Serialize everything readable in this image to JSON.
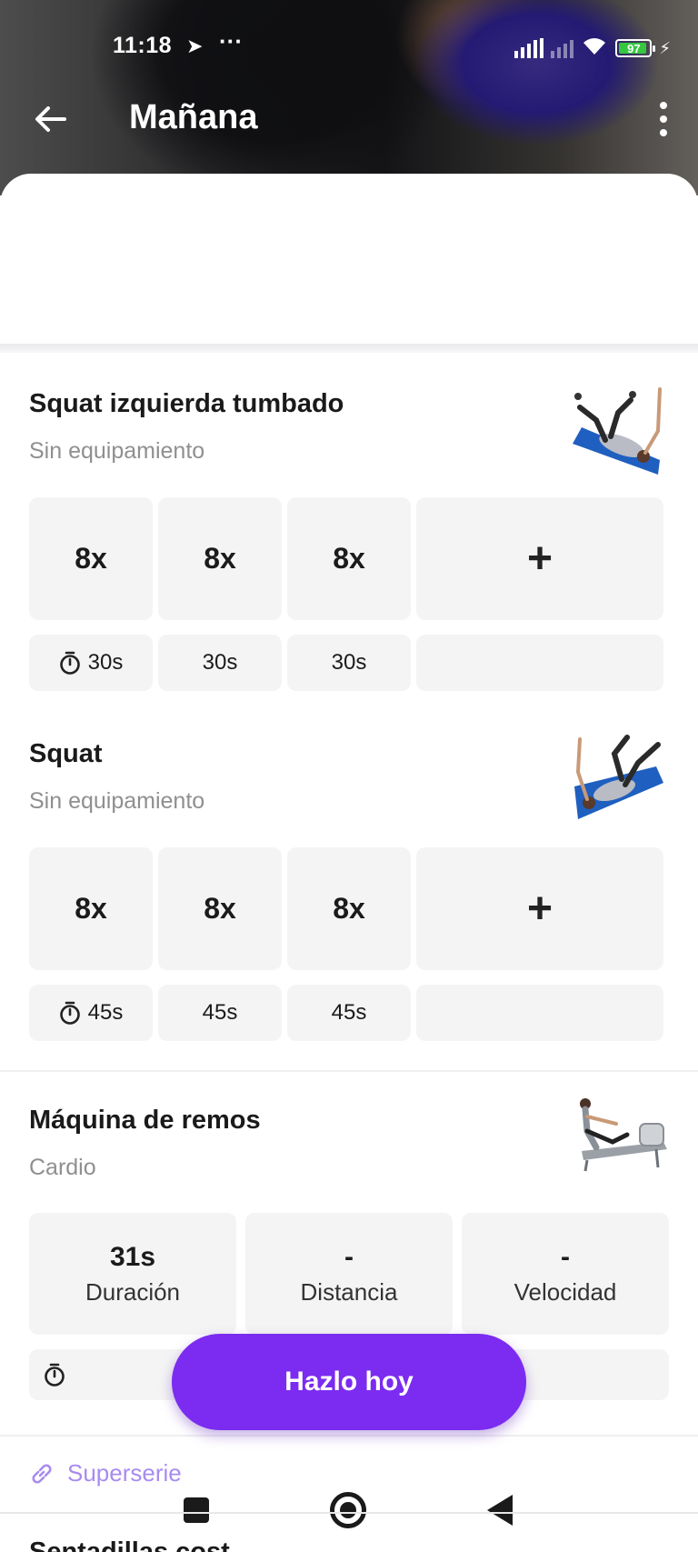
{
  "status_bar": {
    "time": "11:18",
    "battery": "97"
  },
  "header": {
    "title": "Mañana"
  },
  "exercises": [
    {
      "name": "Squat izquierda tumbado",
      "equipment": "Sin equipamiento",
      "reps": [
        "8x",
        "8x",
        "8x"
      ],
      "rests": [
        "30s",
        "30s",
        "30s"
      ]
    },
    {
      "name": "Squat",
      "equipment": "Sin equipamiento",
      "reps": [
        "8x",
        "8x",
        "8x"
      ],
      "rests": [
        "45s",
        "45s",
        "45s"
      ]
    },
    {
      "name": "Máquina de remos",
      "equipment": "Cardio",
      "metrics": [
        {
          "value": "31s",
          "label": "Duración"
        },
        {
          "value": "-",
          "label": "Distancia"
        },
        {
          "value": "-",
          "label": "Velocidad"
        }
      ]
    }
  ],
  "cta": {
    "label": "Hazlo hoy"
  },
  "superserie": {
    "label": "Superserie"
  },
  "next_exercise_partial": "Sentadillas cost",
  "colors": {
    "accent": "#7b2cf0",
    "accent_light": "#a88bf0",
    "cell_bg": "#f4f4f4"
  }
}
